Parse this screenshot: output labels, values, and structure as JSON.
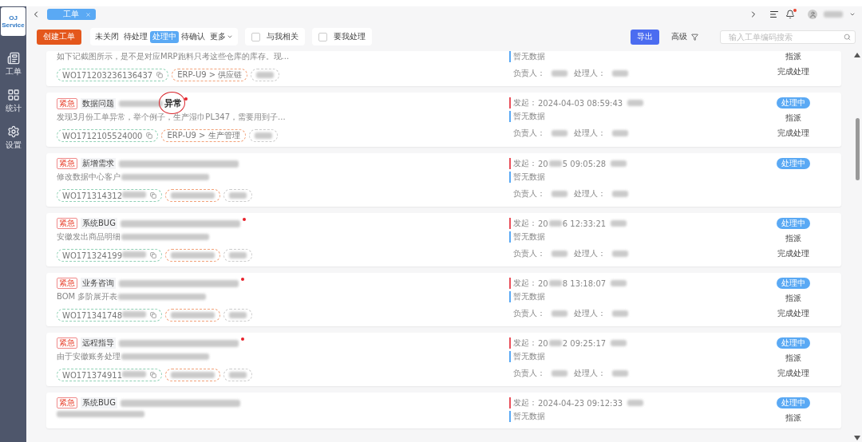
{
  "sidebar": {
    "logo": "OJ Service",
    "items": [
      {
        "label": "工单"
      },
      {
        "label": "统计"
      },
      {
        "label": "设置"
      }
    ]
  },
  "header": {
    "tabs": [
      {
        "label": "工单",
        "selected": true
      }
    ],
    "notifications_unread": true
  },
  "toolbar": {
    "create_button": "创建工单",
    "filters": [
      {
        "label": "未关闭",
        "selected": false
      },
      {
        "label": "待处理",
        "selected": false
      },
      {
        "label": "处理中",
        "selected": true
      },
      {
        "label": "待确认",
        "selected": false
      }
    ],
    "more": "更多",
    "checks": [
      {
        "label": "与我相关",
        "checked": false
      },
      {
        "label": "要我处理",
        "checked": false
      }
    ],
    "export_button": "导出",
    "advanced": "高级",
    "search": {
      "placeholder": "输入工单编码搜索"
    }
  },
  "tickets": [
    {
      "description": [
        {
          "kind": "text",
          "text": "如下记截图所示，是不是对应MRP跑料只考这些仓库的库存。现..."
        }
      ],
      "number": [
        {
          "kind": "text",
          "text": "WO171203236136437"
        }
      ],
      "module": [
        {
          "kind": "text",
          "text": "ERP-U9 > 供应链"
        }
      ],
      "empty_note": "暂无数据",
      "owner_label": "负责人：",
      "handler_label": "处理人：",
      "actions": [
        "指派",
        "完成处理"
      ]
    },
    {
      "priority": "紧急",
      "category": "数据问题",
      "title": [
        {
          "kind": "blurred"
        },
        {
          "kind": "text",
          "text": "异常"
        }
      ],
      "unread": true,
      "circled": true,
      "description": [
        {
          "kind": "text",
          "text": "发现3月份工单异常，举个例子，生产湿巾PL347，需要用到子..."
        }
      ],
      "number": [
        {
          "kind": "text",
          "text": "WO1712105524000"
        }
      ],
      "module": [
        {
          "kind": "text",
          "text": "ERP-U9 > 生产管理"
        }
      ],
      "start_label": "发起：",
      "start_time": [
        {
          "kind": "text",
          "text": "2024-04-03 08:59:43"
        }
      ],
      "empty_note": "暂无数据",
      "owner_label": "负责人：",
      "handler_label": "处理人：",
      "status": "处理中",
      "actions": [
        "指派",
        "完成处理"
      ]
    },
    {
      "priority": "紧急",
      "category": "新增需求",
      "title": [
        {
          "kind": "blurred"
        }
      ],
      "unread": false,
      "description": [
        {
          "kind": "text",
          "text": "修改数据中心客户"
        },
        {
          "kind": "blurred"
        }
      ],
      "number": [
        {
          "kind": "text",
          "text": "WO171314312"
        },
        {
          "kind": "blurred"
        }
      ],
      "module": [
        {
          "kind": "blurred"
        }
      ],
      "start_label": "发起：",
      "start_time": [
        {
          "kind": "text",
          "text": "20"
        },
        {
          "kind": "blurred"
        },
        {
          "kind": "text",
          "text": "5 09:05:28"
        }
      ],
      "empty_note": "暂无数据",
      "owner_label": "负责人：",
      "handler_label": "处理人：",
      "status": "处理中"
    },
    {
      "priority": "紧急",
      "category": "系统BUG",
      "title": [
        {
          "kind": "blurred"
        }
      ],
      "unread": true,
      "description": [
        {
          "kind": "text",
          "text": "安徽发出商品明细"
        },
        {
          "kind": "blurred"
        }
      ],
      "number": [
        {
          "kind": "text",
          "text": "WO171324199"
        },
        {
          "kind": "blurred"
        }
      ],
      "module": [
        {
          "kind": "blurred"
        }
      ],
      "start_label": "发起：",
      "start_time": [
        {
          "kind": "text",
          "text": "20"
        },
        {
          "kind": "blurred"
        },
        {
          "kind": "text",
          "text": "6 12:33:21"
        }
      ],
      "empty_note": "暂无数据",
      "owner_label": "负责人：",
      "handler_label": "处理人：",
      "status": "处理中",
      "actions": [
        "指派",
        "完成处理"
      ]
    },
    {
      "priority": "紧急",
      "category": "业务咨询",
      "title": [
        {
          "kind": "blurred"
        }
      ],
      "unread": true,
      "description": [
        {
          "kind": "text",
          "text": "BOM 多阶展开表"
        },
        {
          "kind": "blurred"
        }
      ],
      "number": [
        {
          "kind": "text",
          "text": "WO171341748"
        },
        {
          "kind": "blurred"
        }
      ],
      "module": [
        {
          "kind": "blurred"
        }
      ],
      "start_label": "发起：",
      "start_time": [
        {
          "kind": "text",
          "text": "20"
        },
        {
          "kind": "blurred"
        },
        {
          "kind": "text",
          "text": "8 13:18:07"
        }
      ],
      "empty_note": "暂无数据",
      "owner_label": "负责人：",
      "handler_label": "处理人：",
      "status": "处理中",
      "actions": [
        "指派",
        "完成处理"
      ]
    },
    {
      "priority": "紧急",
      "category": "远程指导",
      "title": [
        {
          "kind": "blurred"
        }
      ],
      "unread": true,
      "description": [
        {
          "kind": "text",
          "text": "由于安徽账务处理"
        },
        {
          "kind": "blurred"
        }
      ],
      "number": [
        {
          "kind": "text",
          "text": "WO171374911"
        },
        {
          "kind": "blurred"
        }
      ],
      "module": [
        {
          "kind": "blurred"
        }
      ],
      "start_label": "发起：",
      "start_time": [
        {
          "kind": "text",
          "text": "20"
        },
        {
          "kind": "blurred"
        },
        {
          "kind": "text",
          "text": "2 09:25:17"
        }
      ],
      "empty_note": "暂无数据",
      "owner_label": "负责人：",
      "handler_label": "处理人：",
      "status": "处理中",
      "actions": [
        "指派",
        "完成处理"
      ]
    },
    {
      "priority": "紧急",
      "category": "系统BUG",
      "title": [
        {
          "kind": "blurred"
        }
      ],
      "unread": false,
      "description": [
        {
          "kind": "blurred"
        }
      ],
      "start_label": "发起：",
      "start_time": [
        {
          "kind": "text",
          "text": "2024-04-23 09:12:33"
        }
      ],
      "empty_note": "暂无数据",
      "status": "处理中",
      "actions": [
        "指派"
      ]
    }
  ]
}
